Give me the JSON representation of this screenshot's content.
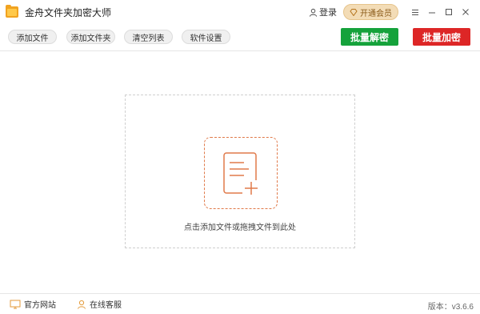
{
  "app": {
    "title": "金舟文件夹加密大师"
  },
  "header": {
    "login_label": "登录",
    "vip_label": "开通会员"
  },
  "toolbar": {
    "buttons": [
      "添加文件",
      "添加文件夹",
      "清空列表",
      "软件设置"
    ],
    "decrypt_label": "批量解密",
    "encrypt_label": "批量加密"
  },
  "dropzone": {
    "hint": "点击添加文件或拖拽文件到此处"
  },
  "footer": {
    "website_label": "官方网站",
    "service_label": "在线客服",
    "version": "版本：v3.6.6"
  },
  "colors": {
    "decrypt": "#15a23b",
    "encrypt": "#dd2626",
    "accent": "#e07a4a",
    "vip": "#f3dcb6"
  }
}
